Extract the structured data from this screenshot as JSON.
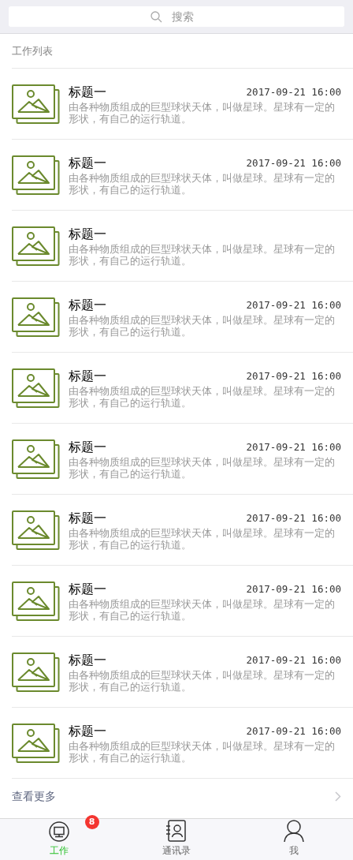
{
  "search": {
    "placeholder": "搜索"
  },
  "section_title": "工作列表",
  "items": [
    {
      "title": "标题一",
      "date": "2017-09-21 16:00",
      "description": "由各种物质组成的巨型球状天体，叫做星球。星球有一定的形状，有自己的运行轨道。"
    },
    {
      "title": "标题一",
      "date": "2017-09-21 16:00",
      "description": "由各种物质组成的巨型球状天体，叫做星球。星球有一定的形状，有自己的运行轨道。"
    },
    {
      "title": "标题一",
      "description": "由各种物质组成的巨型球状天体，叫做星球。星球有一定的形状，有自己的运行轨道。"
    },
    {
      "title": "标题一",
      "date": "2017-09-21 16:00",
      "description": "由各种物质组成的巨型球状天体，叫做星球。星球有一定的形状，有自己的运行轨道。"
    },
    {
      "title": "标题一",
      "date": "2017-09-21 16:00",
      "description": "由各种物质组成的巨型球状天体，叫做星球。星球有一定的形状，有自己的运行轨道。"
    },
    {
      "title": "标题一",
      "date": "2017-09-21 16:00",
      "description": "由各种物质组成的巨型球状天体，叫做星球。星球有一定的形状，有自己的运行轨道。"
    },
    {
      "title": "标题一",
      "date": "2017-09-21 16:00",
      "description": "由各种物质组成的巨型球状天体，叫做星球。星球有一定的形状，有自己的运行轨道。"
    },
    {
      "title": "标题一",
      "date": "2017-09-21 16:00",
      "description": "由各种物质组成的巨型球状天体，叫做星球。星球有一定的形状，有自己的运行轨道。"
    },
    {
      "title": "标题一",
      "date": "2017-09-21 16:00",
      "description": "由各种物质组成的巨型球状天体，叫做星球。星球有一定的形状，有自己的运行轨道。"
    },
    {
      "title": "标题一",
      "date": "2017-09-21 16:00",
      "description": "由各种物质组成的巨型球状天体，叫做星球。星球有一定的形状，有自己的运行轨道。"
    }
  ],
  "more_link": "查看更多",
  "tabs": [
    {
      "kind": "monitor",
      "label": "工作",
      "selected": true,
      "badge": "8"
    },
    {
      "kind": "contacts",
      "label": "通讯录",
      "selected": false
    },
    {
      "kind": "person",
      "label": "我",
      "selected": false
    }
  ]
}
